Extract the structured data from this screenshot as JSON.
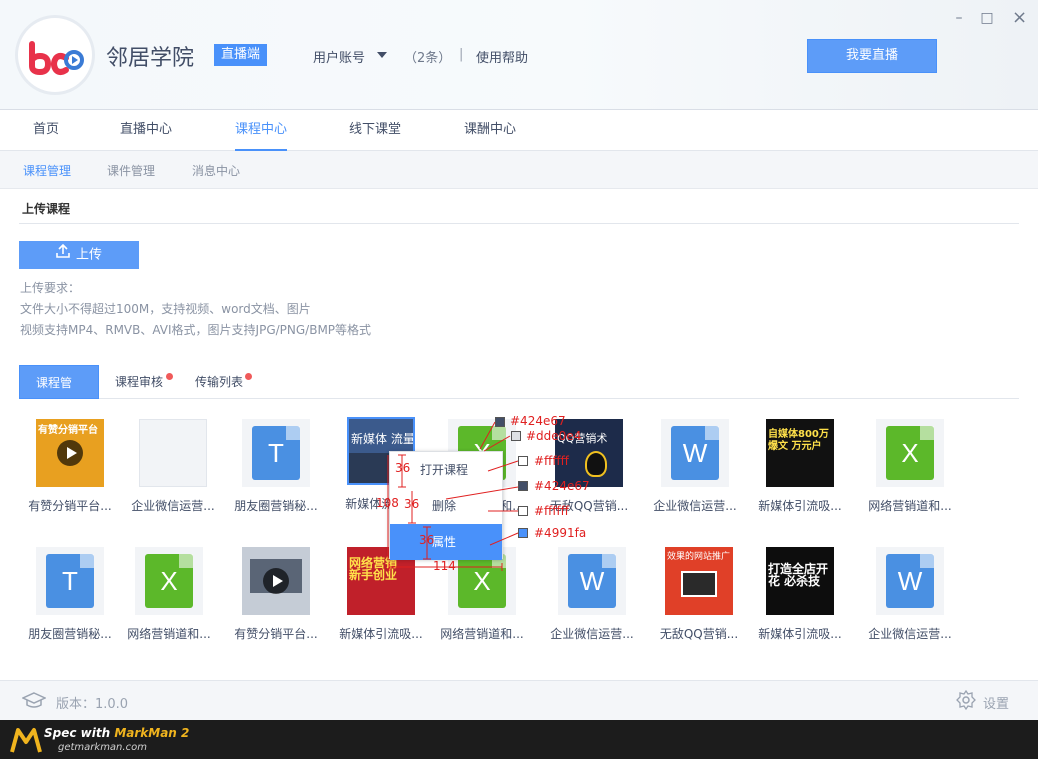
{
  "app": {
    "name": "邻居学院",
    "badge": "直播端"
  },
  "header": {
    "account": "用户账号",
    "count": "（2条）",
    "separator": "|",
    "help": "使用帮助",
    "go_live": "我要直播"
  },
  "window_controls": {
    "minimize": "–",
    "maximize": "□",
    "close": "×"
  },
  "nav": {
    "items": [
      "首页",
      "直播中心",
      "课程中心",
      "线下课堂",
      "课酬中心"
    ],
    "active": "课程中心"
  },
  "subnav": {
    "items": [
      "课程管理",
      "课件管理",
      "消息中心"
    ],
    "active": "课程管理"
  },
  "upload": {
    "title": "上传课程",
    "button": "上传",
    "requirements": [
      "上传要求：",
      "文件大小不得超过100M，支持视频、word文档、图片",
      "视频支持MP4、RMVB、AVI格式，图片支持JPG/PNG/BMP等格式"
    ]
  },
  "tabs": {
    "items": [
      "课程管理",
      "课程审核",
      "传输列表"
    ],
    "active": "课程管理"
  },
  "files_row1": [
    {
      "name": "有赞分销平台...",
      "kind": "video",
      "caption": "有赞分销平台"
    },
    {
      "name": "企业微信运营...",
      "kind": "blank"
    },
    {
      "name": "朋友圈营销秘...",
      "kind": "T"
    },
    {
      "name": "新媒体流量...",
      "kind": "image",
      "caption": "新媒体 流量"
    },
    {
      "name": "网络营销道和...",
      "kind": "X"
    },
    {
      "name": "无敌QQ营销...",
      "kind": "image2",
      "caption": "QQ营销术"
    },
    {
      "name": "企业微信运营...",
      "kind": "W"
    },
    {
      "name": "新媒体引流吸...",
      "kind": "image3",
      "caption": "自媒体800万 爆文 万元户"
    },
    {
      "name": "网络营销道和...",
      "kind": "X"
    }
  ],
  "files_row2": [
    {
      "name": "朋友圈营销秘...",
      "kind": "T"
    },
    {
      "name": "网络营销道和...",
      "kind": "X"
    },
    {
      "name": "有赞分销平台...",
      "kind": "video2"
    },
    {
      "name": "新媒体引流吸...",
      "kind": "image4",
      "caption": "网络营销 新手创业"
    },
    {
      "name": "网络营销道和...",
      "kind": "X"
    },
    {
      "name": "企业微信运营...",
      "kind": "W"
    },
    {
      "name": "无敌QQ营销...",
      "kind": "image5",
      "caption": "效果的网站推广"
    },
    {
      "name": "新媒体引流吸...",
      "kind": "image6",
      "caption": "打造全店开花 必杀技"
    },
    {
      "name": "企业微信运营...",
      "kind": "W"
    }
  ],
  "context_menu": {
    "items": [
      "打开课程",
      "删除",
      "属性"
    ],
    "highlighted": "属性"
  },
  "annotations": {
    "colors": [
      "#424e67",
      "#dde0e4",
      "#ffffff",
      "#424e67",
      "#ffffff",
      "#4991fa"
    ],
    "dims": [
      "36",
      "108",
      "36",
      "36",
      "114"
    ]
  },
  "footer": {
    "version": "版本：1.0.0",
    "settings": "设置"
  },
  "markman": {
    "line1a": "Spec with ",
    "line1b": "MarkMan 2",
    "line2": "getmarkman.com"
  },
  "theme": {
    "accent": "#4991fa",
    "text": "#424e67",
    "excel": "#5cb82a",
    "word": "#4a90e2"
  }
}
